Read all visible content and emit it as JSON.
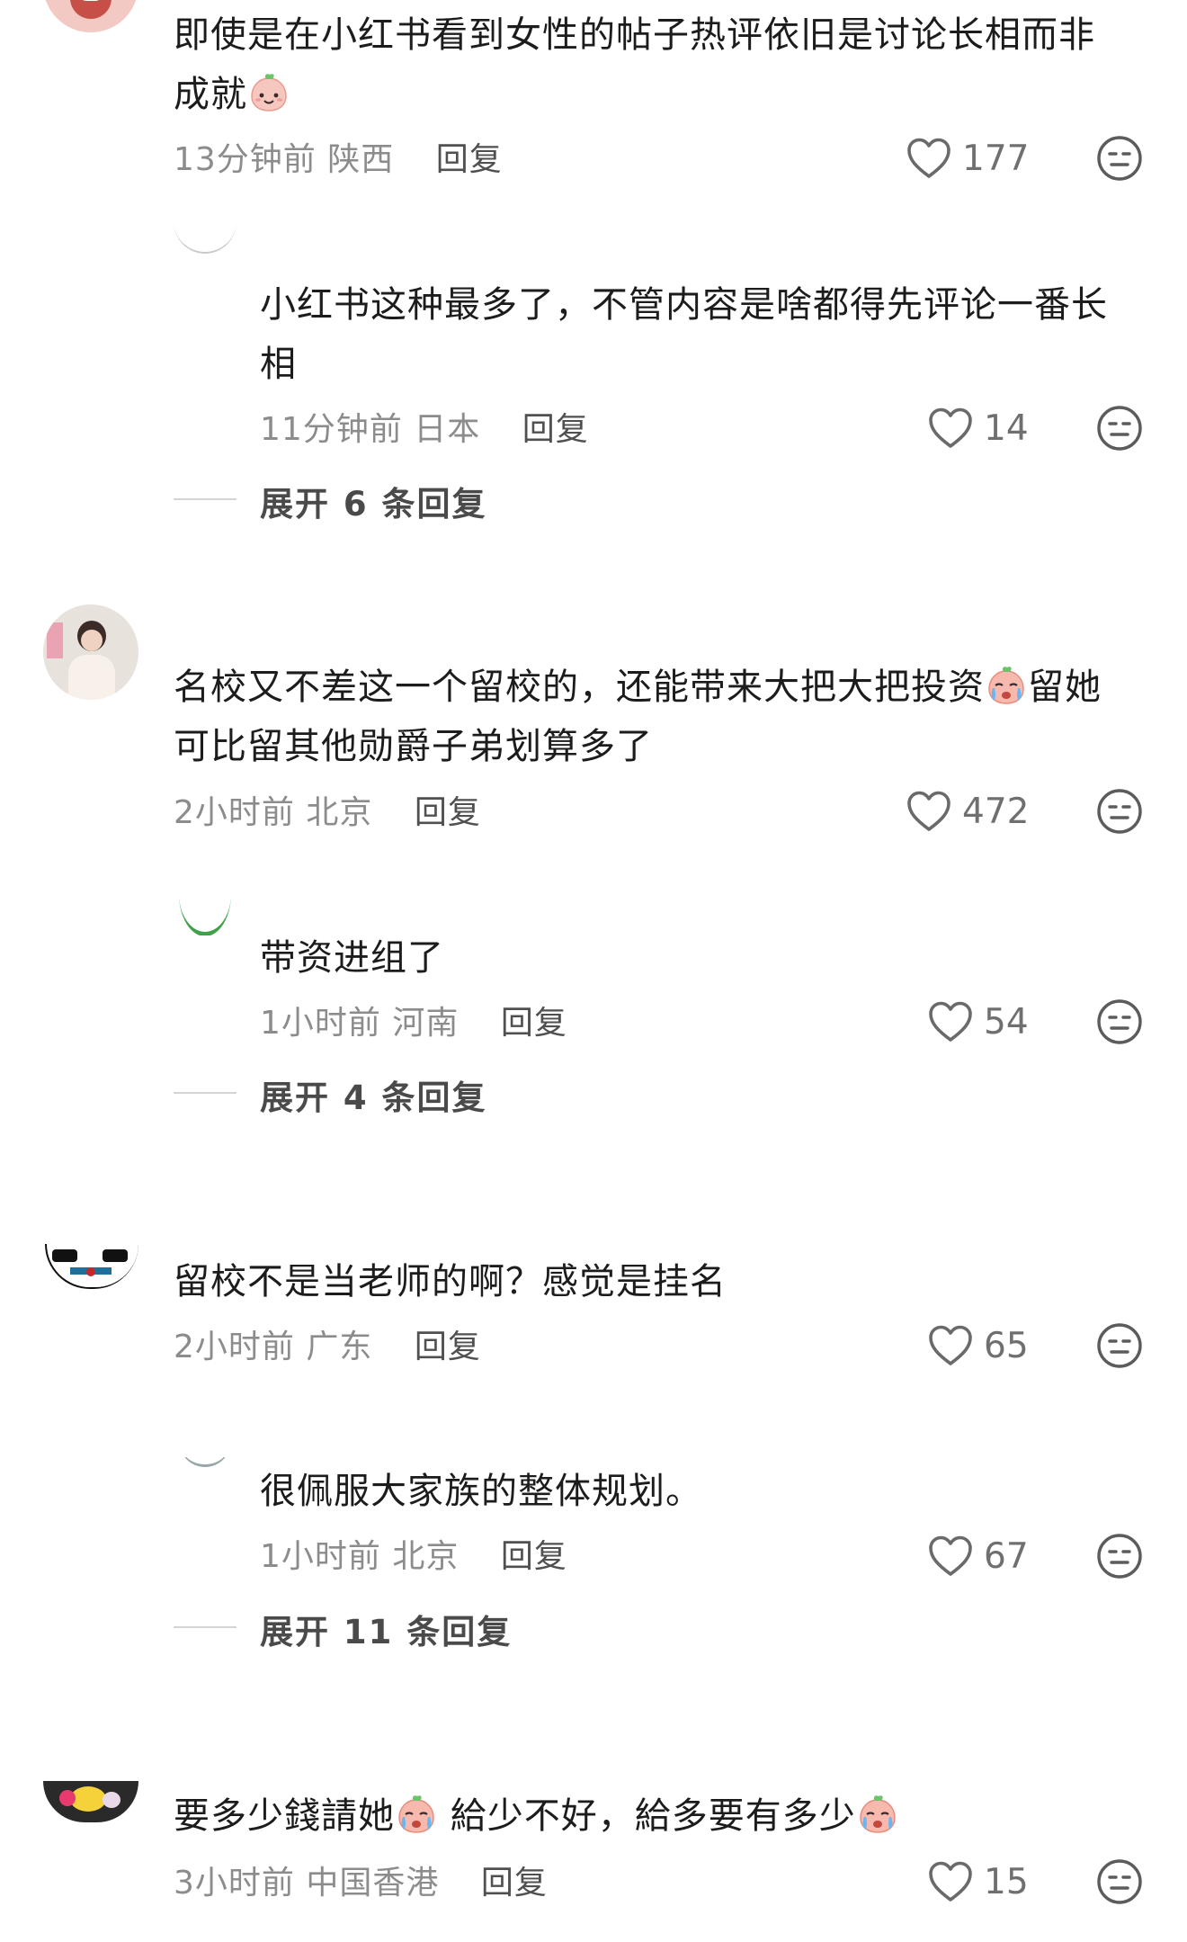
{
  "comments": [
    {
      "text_line1": "即使是在小红书看到女性的帖子热评依旧是讨论长相而非",
      "text_line2": "成就",
      "time": "13分钟前",
      "location": "陕西",
      "reply_label": "回复",
      "likes": "177"
    },
    {
      "text_line1": "小红书这种最多了，不管内容是啥都得先评论一番长",
      "text_line2": "相",
      "time": "11分钟前",
      "location": "日本",
      "reply_label": "回复",
      "likes": "14",
      "expand_label": "展开 6 条回复"
    },
    {
      "text_line1a": "名校又不差这一个留校的，还能带来大把大把投资",
      "text_line1b": "留她",
      "text_line2": "可比留其他勋爵子弟划算多了",
      "time": "2小时前",
      "location": "北京",
      "reply_label": "回复",
      "likes": "472"
    },
    {
      "text_line1": "带资进组了",
      "time": "1小时前",
      "location": "河南",
      "reply_label": "回复",
      "likes": "54",
      "expand_label": "展开 4 条回复"
    },
    {
      "text_line1": "留校不是当老师的啊？感觉是挂名",
      "time": "2小时前",
      "location": "广东",
      "reply_label": "回复",
      "likes": "65"
    },
    {
      "text_line1": "很佩服大家族的整体规划。",
      "time": "1小时前",
      "location": "北京",
      "reply_label": "回复",
      "likes": "67",
      "expand_label": "展开 11 条回复"
    },
    {
      "text_a": "要多少錢請她",
      "text_b": " 給少不好，給多要有多少",
      "time": "3小时前",
      "location": "中国香港",
      "reply_label": "回复",
      "likes": "15"
    }
  ],
  "icons": {
    "like": "heart-outline-icon",
    "dislike": "neutral-face-icon",
    "emoji_smile": "peach-smile-emoji",
    "emoji_cry": "peach-cry-emoji"
  },
  "colors": {
    "text": "#1c1c1c",
    "meta": "#8c8c8c",
    "icon": "#6f6f6f"
  }
}
